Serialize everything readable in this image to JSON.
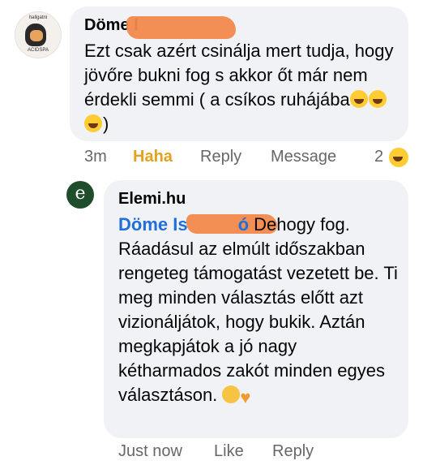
{
  "comment1": {
    "author": "Döme I",
    "text": "Ezt csak azért csinálja mert tudja, hogy jövőre bukni fog s akkor őt már nem érdekli semmi ( a csíkos ruhájába",
    "text_end": ")",
    "avatar_top_text": "hallgatni",
    "avatar_bottom_text": "ACIDSPA",
    "emojis": [
      "laughing-crying",
      "laughing-crying",
      "laughing-crying"
    ],
    "actions": {
      "time": "3m",
      "reaction_label": "Haha",
      "reply_label": "Reply",
      "message_label": "Message",
      "reaction_count": "2"
    }
  },
  "comment2": {
    "author": "Elemi.hu",
    "avatar_letter": "e",
    "mention": "Döme Is",
    "mention_end": "ó",
    "text": "Dehogy fog. Ráadásul az elmúlt időszakban rengeteg támogatást vezetett be. Ti meg minden választás előtt azt vizionáljátok, hogy bukik. Aztán megkapjátok a jó nagy kétharmados zakót minden egyes választáson.",
    "emojis": [
      "ok-hand",
      "orange-heart"
    ],
    "actions": {
      "time": "Just now",
      "like_label": "Like",
      "reply_label": "Reply"
    }
  },
  "colors": {
    "bubble": "#f0f2f5",
    "mention": "#216fdb",
    "haha": "#e4a11b",
    "meta": "#65676b",
    "redaction": "#f2884b",
    "avatar_page": "#1f4d2c"
  }
}
